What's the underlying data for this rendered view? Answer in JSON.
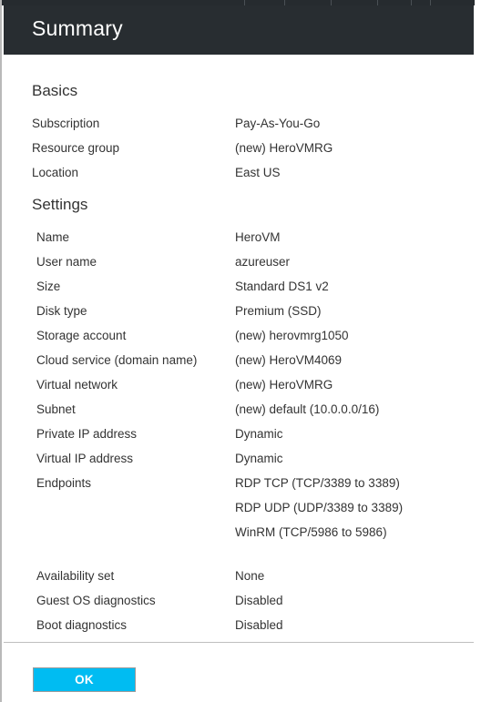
{
  "header": {
    "title": "Summary"
  },
  "top_strip": {
    "divider_positions": [
      266,
      310,
      361,
      412,
      449,
      470
    ]
  },
  "sections": [
    {
      "id": "basics",
      "title": "Basics",
      "rows": [
        {
          "label": "Subscription",
          "value": "Pay-As-You-Go"
        },
        {
          "label": "Resource group",
          "value": "(new) HeroVMRG"
        },
        {
          "label": "Location",
          "value": "East US"
        }
      ]
    },
    {
      "id": "settings",
      "title": "Settings",
      "rows": [
        {
          "label": "Name",
          "value": "HeroVM"
        },
        {
          "label": "User name",
          "value": "azureuser"
        },
        {
          "label": "Size",
          "value": "Standard DS1 v2"
        },
        {
          "label": "Disk type",
          "value": "Premium (SSD)"
        },
        {
          "label": "Storage account",
          "value": "(new) herovmrg1050"
        },
        {
          "label": "Cloud service (domain name)",
          "value": "(new) HeroVM4069"
        },
        {
          "label": "Virtual network",
          "value": "(new) HeroVMRG"
        },
        {
          "label": "Subnet",
          "value": "(new) default (10.0.0.0/16)"
        },
        {
          "label": "Private IP address",
          "value": "Dynamic"
        },
        {
          "label": "Virtual IP address",
          "value": "Dynamic"
        },
        {
          "label": "Endpoints",
          "values": [
            "RDP TCP (TCP/3389 to 3389)",
            "RDP UDP (UDP/3389 to 3389)",
            "WinRM (TCP/5986 to 5986)"
          ]
        },
        {
          "label": "Availability set",
          "value": "None",
          "extra_gap": true
        },
        {
          "label": "Guest OS diagnostics",
          "value": "Disabled"
        },
        {
          "label": "Boot diagnostics",
          "value": "Disabled"
        }
      ]
    }
  ],
  "footer": {
    "ok_label": "OK"
  },
  "colors": {
    "header_background": "#282d31",
    "accent_button": "#00bcf2",
    "text": "#333333",
    "separator": "#bfbfbf"
  }
}
